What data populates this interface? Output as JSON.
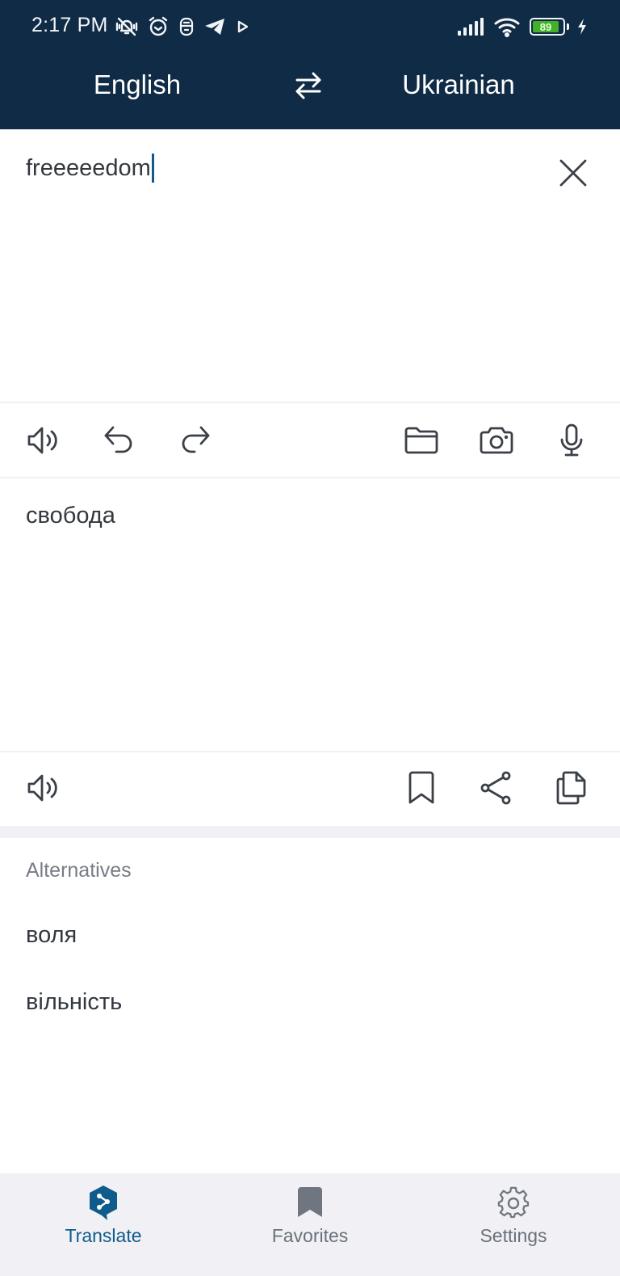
{
  "status_bar": {
    "time": "2:17 PM",
    "left_icons": [
      "vibrate-silent-icon",
      "alarm-icon",
      "app-notification-icon",
      "telegram-icon",
      "play-store-icon"
    ],
    "right_icons": [
      "signal-icon",
      "wifi-icon",
      "battery-icon",
      "charging-icon"
    ],
    "battery_percent": "89"
  },
  "header": {
    "source_language": "English",
    "target_language": "Ukrainian",
    "swap_icon": "swap-arrows-icon"
  },
  "source": {
    "text": "freeeeedom",
    "clear_icon": "close-icon"
  },
  "source_toolbar": {
    "left": [
      {
        "name": "speaker",
        "icon": "speaker-icon"
      },
      {
        "name": "undo",
        "icon": "undo-icon"
      },
      {
        "name": "redo",
        "icon": "redo-icon"
      }
    ],
    "right": [
      {
        "name": "file",
        "icon": "folder-icon"
      },
      {
        "name": "camera",
        "icon": "camera-icon"
      },
      {
        "name": "microphone",
        "icon": "microphone-icon"
      }
    ]
  },
  "target": {
    "text": "свобода"
  },
  "target_toolbar": {
    "left": [
      {
        "name": "speaker",
        "icon": "speaker-icon"
      }
    ],
    "right": [
      {
        "name": "bookmark",
        "icon": "bookmark-icon"
      },
      {
        "name": "share",
        "icon": "share-icon"
      },
      {
        "name": "copy",
        "icon": "copy-icon"
      }
    ]
  },
  "alternatives": {
    "heading": "Alternatives",
    "items": [
      "воля",
      "вільність"
    ]
  },
  "bottom_nav": {
    "items": [
      {
        "label": "Translate",
        "icon": "translate-logo-icon",
        "active": true
      },
      {
        "label": "Favorites",
        "icon": "bookmark-filled-icon",
        "active": false
      },
      {
        "label": "Settings",
        "icon": "gear-icon",
        "active": false
      }
    ]
  },
  "colors": {
    "header_bg": "#0f2b46",
    "accent": "#0f5c8c",
    "text": "#333840",
    "muted": "#767d86",
    "nav_bg": "#f1f1f5",
    "battery_green": "#43b02a"
  }
}
